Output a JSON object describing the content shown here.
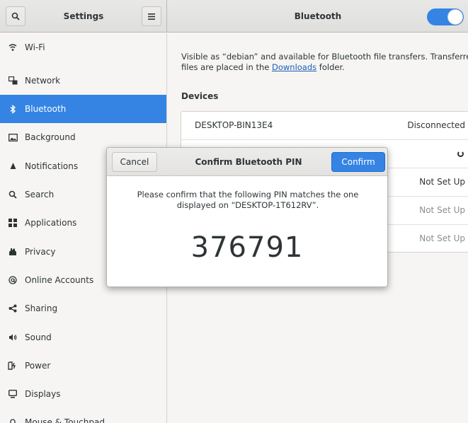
{
  "header": {
    "settings_title": "Settings",
    "panel_title": "Bluetooth",
    "bluetooth_enabled": true,
    "accent_color": "#3584e4"
  },
  "sidebar": {
    "items": [
      {
        "label": "Wi-Fi",
        "icon": "wifi-icon"
      },
      {
        "label": "Network",
        "icon": "network-icon"
      },
      {
        "label": "Bluetooth",
        "icon": "bluetooth-icon",
        "active": true
      },
      {
        "label": "Background",
        "icon": "background-icon"
      },
      {
        "label": "Notifications",
        "icon": "notifications-icon"
      },
      {
        "label": "Search",
        "icon": "search-icon"
      },
      {
        "label": "Applications",
        "icon": "applications-icon"
      },
      {
        "label": "Privacy",
        "icon": "privacy-icon"
      },
      {
        "label": "Online Accounts",
        "icon": "online-accounts-icon"
      },
      {
        "label": "Sharing",
        "icon": "sharing-icon"
      },
      {
        "label": "Sound",
        "icon": "sound-icon"
      },
      {
        "label": "Power",
        "icon": "power-icon"
      },
      {
        "label": "Displays",
        "icon": "displays-icon"
      },
      {
        "label": "Mouse & Touchpad",
        "icon": "mouse-icon"
      }
    ]
  },
  "content": {
    "desc_line1": "Visible as “debian” and available for Bluetooth file transfers. Transferred",
    "desc_line2_pre": "files are placed in the ",
    "desc_link": "Downloads",
    "desc_line2_post": " folder.",
    "devices_title": "Devices",
    "devices": [
      {
        "name": "DESKTOP-BIN13E4",
        "status": "Disconnected"
      },
      {
        "name": "",
        "status": "",
        "spinner": true
      },
      {
        "name": "",
        "status": "Not Set Up"
      },
      {
        "name": "",
        "status": "Not Set Up",
        "dim": true
      },
      {
        "name": "",
        "status": "Not Set Up",
        "dim": true
      }
    ]
  },
  "dialog": {
    "cancel_label": "Cancel",
    "title": "Confirm Bluetooth PIN",
    "confirm_label": "Confirm",
    "message_line1": "Please confirm that the following PIN matches the one",
    "message_line2": "displayed on “DESKTOP-1T612RV”.",
    "pin": "376791"
  }
}
